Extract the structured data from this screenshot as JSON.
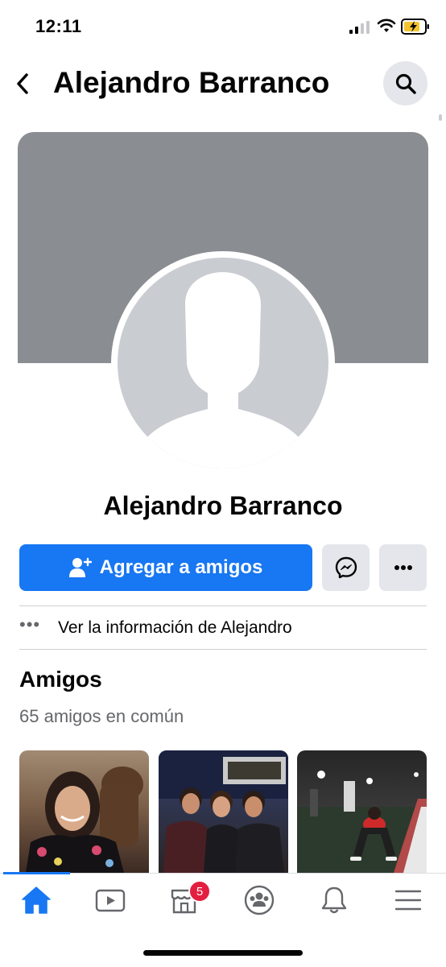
{
  "status_bar": {
    "time": "12:11"
  },
  "header": {
    "title": "Alejandro Barranco"
  },
  "profile": {
    "name": "Alejandro Barranco"
  },
  "actions": {
    "add_friend_label": "Agregar a amigos"
  },
  "info_row": {
    "dots": "•••",
    "label": "Ver la información de Alejandro"
  },
  "friends": {
    "title": "Amigos",
    "mutual_count": "65 amigos en común"
  },
  "tab_bar": {
    "items": [
      {
        "id": "home",
        "icon": "home-icon",
        "active": true
      },
      {
        "id": "watch",
        "icon": "video-icon"
      },
      {
        "id": "marketplace",
        "icon": "marketplace-icon",
        "badge": "5"
      },
      {
        "id": "groups",
        "icon": "groups-icon"
      },
      {
        "id": "notifications",
        "icon": "bell-icon"
      },
      {
        "id": "menu",
        "icon": "menu-icon"
      }
    ]
  },
  "colors": {
    "accent": "#1877f2",
    "badge": "#e41e3f",
    "cover": "#8a8d91",
    "button_gray": "#e4e6eb"
  }
}
